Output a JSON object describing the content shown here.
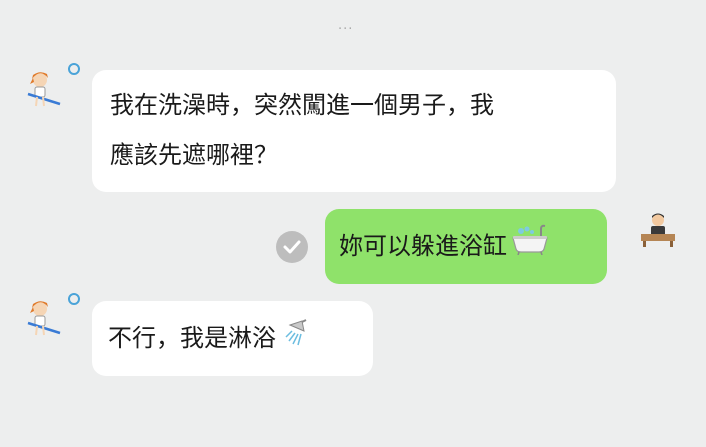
{
  "header": {
    "more_indicator": "···"
  },
  "messages": [
    {
      "sender": "them",
      "text_line1": "我在洗澡時，突然闖進一個男子，我",
      "text_line2": "應該先遮哪裡？"
    },
    {
      "sender": "me",
      "text": "妳可以躲進浴缸",
      "emoji": "bathtub-icon",
      "read": true
    },
    {
      "sender": "them",
      "text": "不行，我是淋浴",
      "emoji": "shower-icon"
    }
  ],
  "colors": {
    "background": "#edeeee",
    "incoming_bubble": "#ffffff",
    "outgoing_bubble": "#8fe26a",
    "status_ring": "#4aa3d8",
    "read_check": "#bdbdbd"
  }
}
